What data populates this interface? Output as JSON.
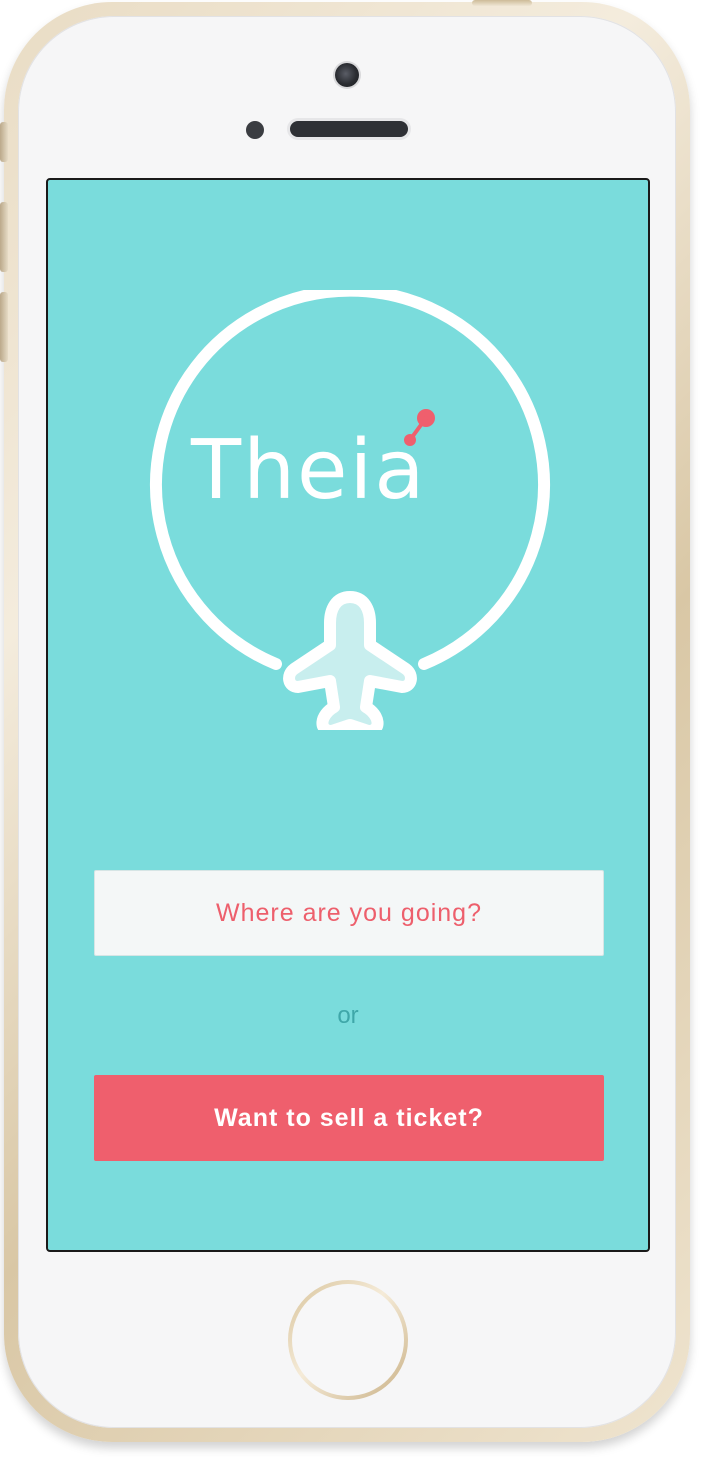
{
  "app": {
    "name": "Theia"
  },
  "buttons": {
    "where_going": "Where are you going?",
    "sell_ticket": "Want to sell a ticket?"
  },
  "separator": {
    "text": "or"
  },
  "icons": {
    "logo": "airplane-circle-logo-icon",
    "camera": "camera-icon",
    "home": "home-button-icon"
  },
  "colors": {
    "screen_background": "#7adcdc",
    "accent": "#ef5f6d",
    "secondary_button_bg": "#f4f7f7",
    "separator_text": "#3fa7a9"
  }
}
